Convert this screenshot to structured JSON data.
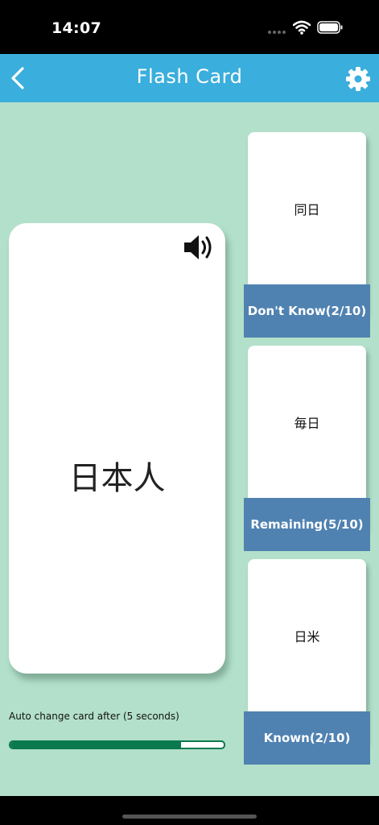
{
  "status_bar": {
    "time": "14:07"
  },
  "app_bar": {
    "title": "Flash Card",
    "back_icon": "chevron-left-icon",
    "settings_icon": "gear-icon"
  },
  "main_card": {
    "word": "日本人",
    "speaker_icon": "speaker-icon"
  },
  "piles": [
    {
      "word": "同日",
      "label": "Don't Know(2/10)"
    },
    {
      "word": "毎日",
      "label": "Remaining(5/10)"
    },
    {
      "word": "日米",
      "label": "Known(2/10)"
    }
  ],
  "auto_change": {
    "text": "Auto change card after (5 seconds)",
    "progress": 0.8
  },
  "colors": {
    "app_bar": "#3aaedc",
    "background": "#b3e0ca",
    "pile_label": "#4f82b1",
    "progress": "#0a7a4e"
  }
}
